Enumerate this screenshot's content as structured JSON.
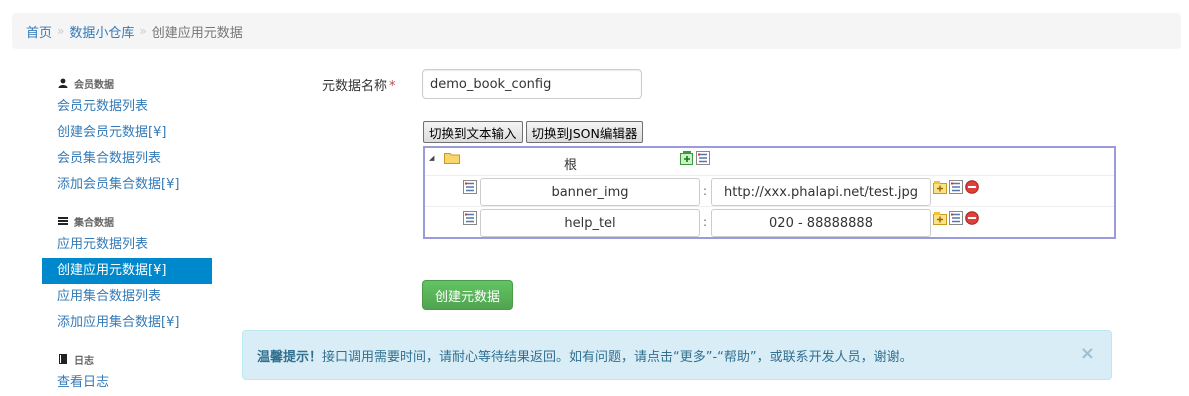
{
  "breadcrumb": {
    "home": "首页",
    "separator": "»",
    "warehouse": "数据小仓库",
    "current": "创建应用元数据"
  },
  "sidebar": {
    "section_member": {
      "header": "会员数据",
      "icon": "user-icon",
      "items": [
        "会员元数据列表",
        "创建会员元数据[¥]",
        "会员集合数据列表",
        "添加会员集合数据[¥]"
      ]
    },
    "section_collection": {
      "header": "集合数据",
      "icon": "hdd-icon",
      "items": [
        "应用元数据列表",
        "创建应用元数据[¥]",
        "应用集合数据列表",
        "添加应用集合数据[¥]"
      ],
      "active_index": 1
    },
    "section_log": {
      "header": "日志",
      "icon": "book-icon",
      "items": [
        "查看日志"
      ]
    }
  },
  "form": {
    "name_label": "元数据名称",
    "required_mark": "*",
    "name_value": "demo_book_config"
  },
  "editor": {
    "btn_text_mode": "切换到文本输入",
    "btn_json_mode": "切换到JSON编辑器",
    "root_label": "根",
    "colon": ":",
    "rows": [
      {
        "key": "banner_img",
        "value": "http://xxx.phalapi.net/test.jpg"
      },
      {
        "key": "help_tel",
        "value": "020 - 88888888"
      }
    ]
  },
  "actions": {
    "create_label": "创建元数据"
  },
  "alert": {
    "title": "温馨提示！",
    "message": "接口调用需要时间，请耐心等待结果返回。如有问题，请点击“更多”-“帮助”，或联系开发人员，谢谢。",
    "close": "×"
  },
  "colors": {
    "link": "#337ab7",
    "active": "#0088cc",
    "success": "#5bb75b",
    "info_bg": "#d9edf7"
  }
}
